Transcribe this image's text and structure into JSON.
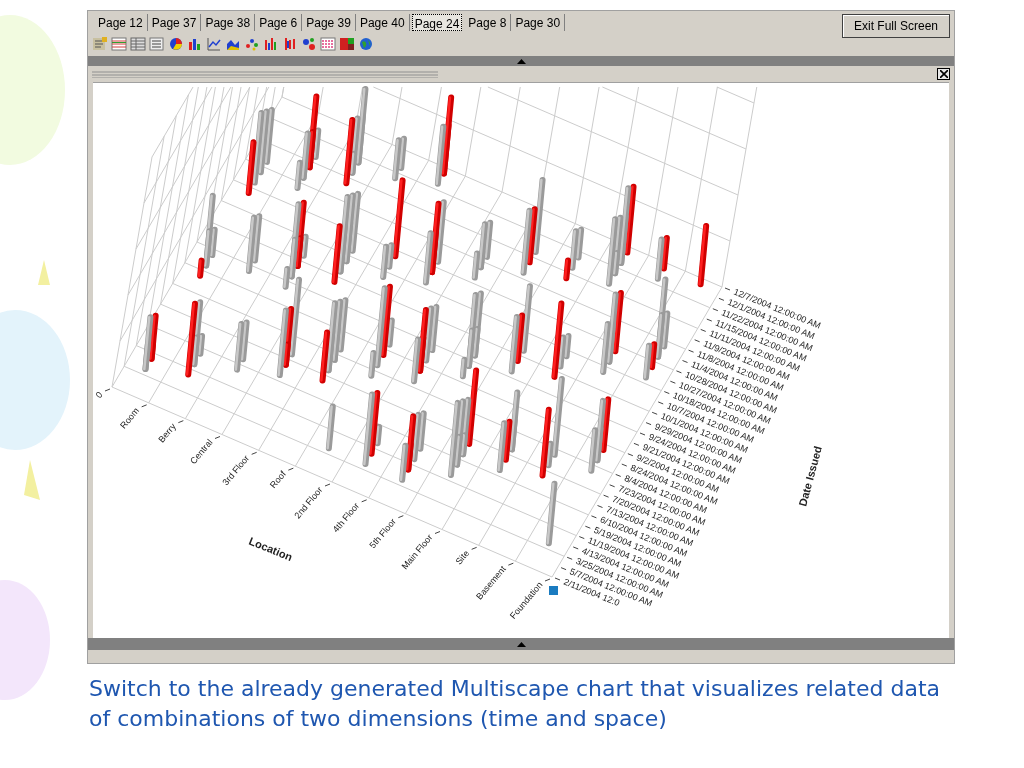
{
  "tabs": [
    {
      "label": "Page 12",
      "selected": false
    },
    {
      "label": "Page 37",
      "selected": false
    },
    {
      "label": "Page 38",
      "selected": false
    },
    {
      "label": "Page 6",
      "selected": false
    },
    {
      "label": "Page 39",
      "selected": false
    },
    {
      "label": "Page 40",
      "selected": false
    },
    {
      "label": "Page 24",
      "selected": true
    },
    {
      "label": "Page 8",
      "selected": false
    },
    {
      "label": "Page 30",
      "selected": false
    }
  ],
  "exit_button": "Exit Full Screen",
  "chart": {
    "location_axis": {
      "title": "Location",
      "labels": [
        "0",
        "Room",
        "Berry",
        "Central",
        "3rd Floor",
        "Roof",
        "2nd Floor",
        "4th Floor",
        "5th Floor",
        "Main Floor",
        "Site",
        "Basement",
        "Foundation"
      ]
    },
    "date_axis": {
      "title": "Date Issued",
      "labels": [
        "2/11/2004 12:0",
        "5/7/2004 12:00:00 AM",
        "3/25/2004 12:00:00 AM",
        "4/13/2004 12:00:00 AM",
        "11/19/2004 12:00:00 AM",
        "5/19/2004 12:00:00 AM",
        "6/10/2004 12:00:00 AM",
        "7/13/2004 12:00:00 AM",
        "7/20/2004 12:00:00 AM",
        "7/23/2004 12:00:00 AM",
        "8/4/2004 12:00:00 AM",
        "8/24/2004 12:00:00 AM",
        "9/2/2004 12:00:00 AM",
        "9/21/2004 12:00:00 AM",
        "9/24/2004 12:00:00 AM",
        "9/29/2004 12:00:00 AM",
        "10/1/2004 12:00:00 AM",
        "10/7/2004 12:00:00 AM",
        "10/18/2004 12:00:00 AM",
        "10/27/2004 12:00:00 AM",
        "10/28/2004 12:00:00 AM",
        "11/4/2004 12:00:00 AM",
        "11/8/2004 12:00:00 AM",
        "11/9/2004 12:00:00 AM",
        "11/11/2004 12:00:00 AM",
        "11/15/2004 12:00:00 AM",
        "11/22/2004 12:00:00 AM",
        "12/1/2004 12:00:00 AM",
        "12/7/2004 12:00:00 AM"
      ]
    }
  },
  "caption": "Switch to the already generated Multiscape chart that visualizes related data of combinations of two dimensions (time and space)"
}
